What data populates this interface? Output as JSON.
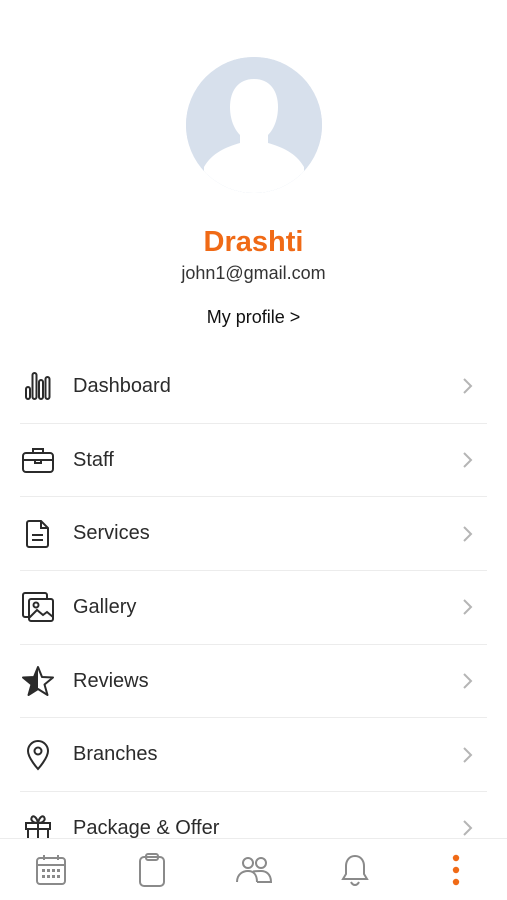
{
  "profile": {
    "name": "Drashti",
    "email": "john1@gmail.com",
    "profile_link": "My profile >"
  },
  "menu": {
    "items": [
      {
        "label": "Dashboard",
        "icon": "bar-chart-icon"
      },
      {
        "label": "Staff",
        "icon": "briefcase-icon"
      },
      {
        "label": "Services",
        "icon": "document-icon"
      },
      {
        "label": "Gallery",
        "icon": "gallery-icon"
      },
      {
        "label": "Reviews",
        "icon": "star-icon"
      },
      {
        "label": "Branches",
        "icon": "location-pin-icon"
      },
      {
        "label": "Package & Offer",
        "icon": "gift-icon"
      }
    ]
  },
  "bottom_nav": {
    "items": [
      {
        "icon": "calendar-icon",
        "active": false
      },
      {
        "icon": "clipboard-icon",
        "active": false
      },
      {
        "icon": "people-icon",
        "active": false
      },
      {
        "icon": "bell-icon",
        "active": false
      },
      {
        "icon": "more-vertical-icon",
        "active": true
      }
    ]
  },
  "colors": {
    "accent": "#f06a16",
    "avatar_bg": "#d7e0ec",
    "icon": "#2b2b2b",
    "chevron": "#b5b5b5",
    "nav_icon": "#8a8a8a"
  }
}
